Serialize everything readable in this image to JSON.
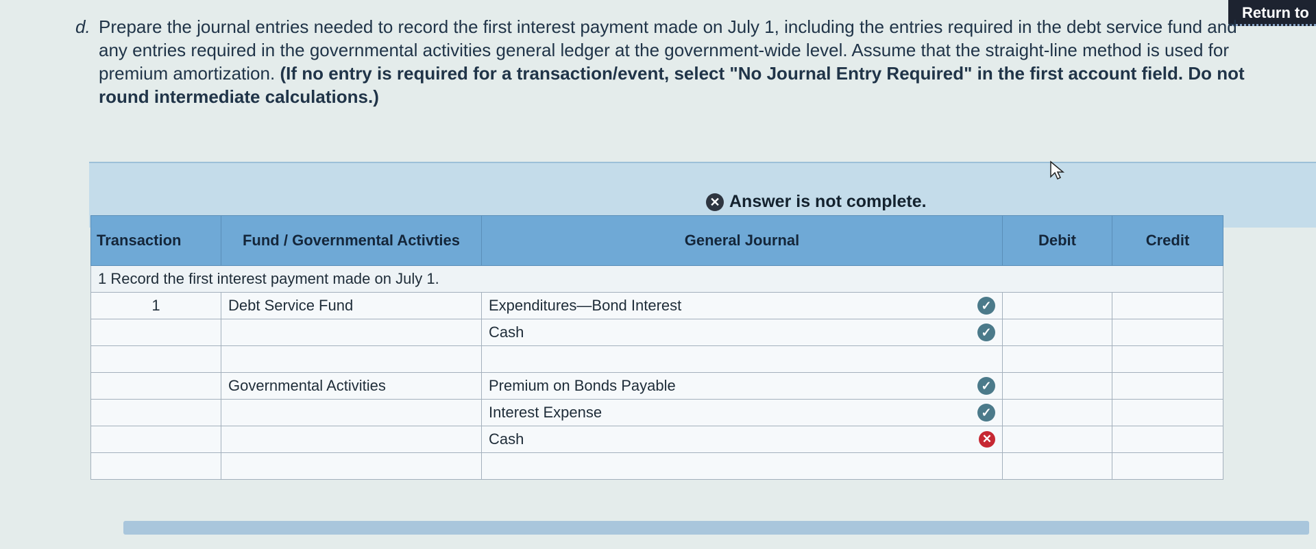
{
  "return_button": {
    "label": "Return to"
  },
  "instructions": {
    "question_letter": "d.",
    "text": "Prepare the journal entries needed to record the first interest payment made on July 1, including the entries required in the debt service fund and any entries required in the governmental activities general ledger at the government-wide level. Assume that the straight-line method is used for premium amortization.",
    "bold_text": "(If no entry is required for a transaction/event, select \"No Journal Entry Required\" in the first account field. Do not round intermediate calculations.)"
  },
  "answer_status": {
    "label": "Answer is not complete."
  },
  "table": {
    "headers": {
      "transaction": "Transaction",
      "fund": "Fund / Governmental Activties",
      "general_journal": "General Journal",
      "debit": "Debit",
      "credit": "Credit"
    },
    "description": "1  Record the first interest payment made on July 1.",
    "rows": [
      {
        "transaction": "1",
        "fund": "Debt Service Fund",
        "account": "Expenditures—Bond Interest",
        "status": "correct",
        "debit": "",
        "credit": ""
      },
      {
        "transaction": "",
        "fund": "",
        "account": "Cash",
        "status": "correct",
        "debit": "",
        "credit": ""
      },
      {
        "transaction": "",
        "fund": "",
        "account": "",
        "status": "",
        "debit": "",
        "credit": ""
      },
      {
        "transaction": "",
        "fund": "Governmental Activities",
        "account": "Premium on Bonds Payable",
        "status": "correct",
        "debit": "",
        "credit": ""
      },
      {
        "transaction": "",
        "fund": "",
        "account": "Interest Expense",
        "status": "correct",
        "debit": "",
        "credit": ""
      },
      {
        "transaction": "",
        "fund": "",
        "account": "Cash",
        "status": "incorrect",
        "debit": "",
        "credit": ""
      },
      {
        "transaction": "",
        "fund": "",
        "account": "",
        "status": "",
        "debit": "",
        "credit": ""
      }
    ]
  },
  "icons": {
    "correct": "check-circle-icon",
    "incorrect": "x-circle-icon",
    "status": "x-circle-icon"
  },
  "colors": {
    "header_bg": "#6fa9d6",
    "correct": "#4b7a8a",
    "incorrect": "#c62832",
    "return_bg": "#1d2330"
  }
}
